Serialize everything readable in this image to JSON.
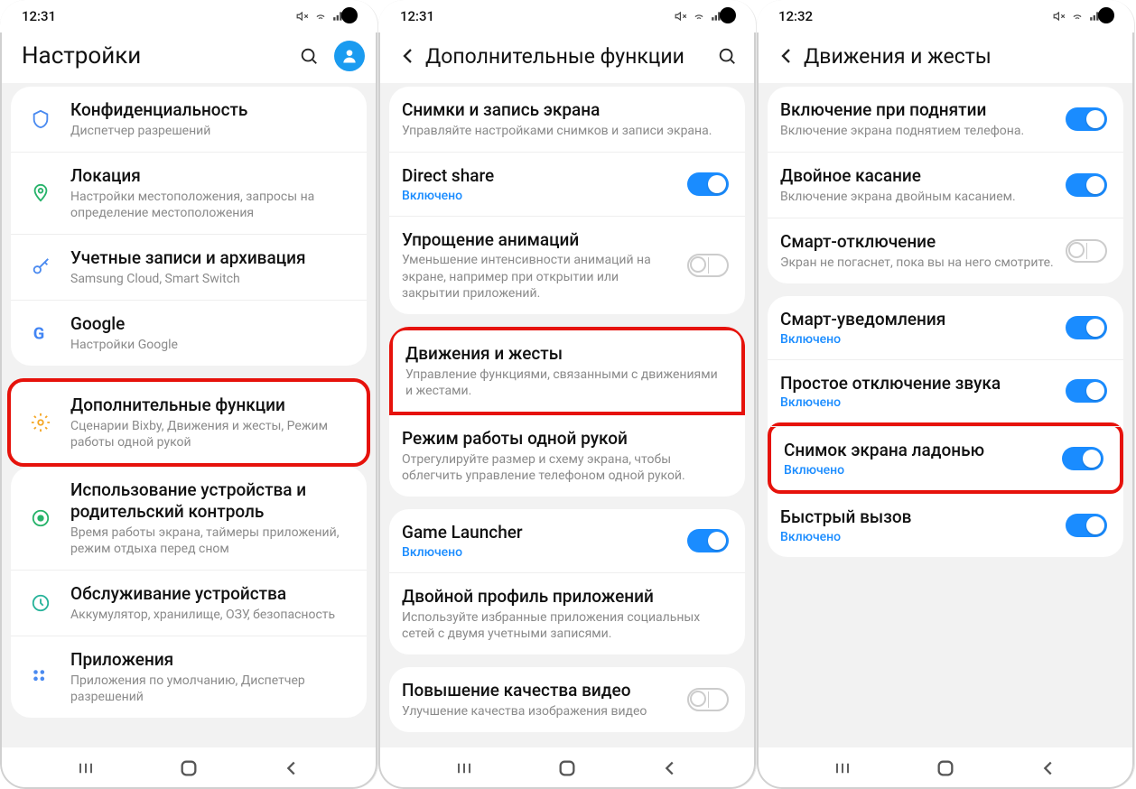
{
  "phones": [
    {
      "time": "12:31",
      "title": "Настройки",
      "has_back": false,
      "has_search": true,
      "has_avatar": true,
      "cards": [
        {
          "highlight_index": -1,
          "rows": [
            {
              "icon": "shield",
              "icon_color": "#4a8af0",
              "title": "Конфиденциальность",
              "sub": "Диспетчер разрешений"
            },
            {
              "icon": "pin",
              "icon_color": "#27b36a",
              "title": "Локация",
              "sub": "Настройки местоположения, запросы на определение местоположения"
            },
            {
              "icon": "key",
              "icon_color": "#4a8af0",
              "title": "Учетные записи и архивация",
              "sub": "Samsung Cloud, Smart Switch"
            },
            {
              "icon": "google",
              "icon_color": "#4285f4",
              "title": "Google",
              "sub": "Настройки Google"
            }
          ]
        },
        {
          "highlight_index": 0,
          "rows": [
            {
              "icon": "gear",
              "icon_color": "#f5a623",
              "title": "Дополнительные функции",
              "sub": "Сценарии Bixby, Движения и жесты, Режим работы одной рукой"
            }
          ]
        },
        {
          "highlight_index": -1,
          "rows": [
            {
              "icon": "wellbeing",
              "icon_color": "#27b36a",
              "title": "Использование устройства и родительский контроль",
              "sub": "Время работы экрана, таймеры приложений, режим отдыха перед сном"
            },
            {
              "icon": "care",
              "icon_color": "#27b39a",
              "title": "Обслуживание устройства",
              "sub": "Аккумулятор, хранилище, ОЗУ, безопасность"
            },
            {
              "icon": "apps",
              "icon_color": "#4a8af0",
              "title": "Приложения",
              "sub": "Приложения по умолчанию, Диспетчер разрешений"
            }
          ]
        }
      ]
    },
    {
      "time": "12:31",
      "title": "Дополнительные функции",
      "has_back": true,
      "has_search": true,
      "has_avatar": false,
      "cards": [
        {
          "highlight_index": -1,
          "rows": [
            {
              "title": "Снимки и запись экрана",
              "sub": "Управляйте настройками снимков и записи экрана."
            },
            {
              "title": "Direct share",
              "status": "Включено",
              "toggle": "on"
            },
            {
              "title": "Упрощение анимаций",
              "sub": "Уменьшение интенсивности анимаций на экране, например при открытии или закрытии приложений.",
              "toggle": "split"
            }
          ]
        },
        {
          "highlight_index": 0,
          "rows": [
            {
              "title": "Движения и жесты",
              "sub": "Управление функциями, связанными с движениями и жестами."
            },
            {
              "title": "Режим работы одной рукой",
              "sub": "Отрегулируйте размер и схему экрана, чтобы облегчить управление телефоном одной рукой."
            }
          ]
        },
        {
          "highlight_index": -1,
          "rows": [
            {
              "title": "Game Launcher",
              "status": "Включено",
              "toggle": "on"
            },
            {
              "title": "Двойной профиль приложений",
              "sub": "Используйте избранные приложения социальных сетей с двумя учетными записями."
            }
          ]
        },
        {
          "highlight_index": -1,
          "rows": [
            {
              "title": "Повышение качества видео",
              "sub": "Улучшение качества изображения видео",
              "toggle": "split"
            }
          ]
        }
      ]
    },
    {
      "time": "12:32",
      "title": "Движения и жесты",
      "has_back": true,
      "has_search": false,
      "has_avatar": false,
      "cards": [
        {
          "highlight_index": -1,
          "rows": [
            {
              "title": "Включение при поднятии",
              "sub": "Включение экрана поднятием телефона.",
              "toggle": "on"
            },
            {
              "title": "Двойное касание",
              "sub": "Включение экрана двойным касанием.",
              "toggle": "on"
            },
            {
              "title": "Смарт-отключение",
              "sub": "Экран не погаснет, пока вы на него смотрите.",
              "toggle": "split"
            }
          ]
        },
        {
          "highlight_index": 3,
          "rows": [
            {
              "title": "Смарт-уведомления",
              "status": "Включено",
              "toggle": "on"
            },
            {
              "title": "Простое отключение звука",
              "status": "Включено",
              "toggle": "on"
            },
            {
              "title": "Быстрый вызов",
              "status": "Включено",
              "toggle": "on"
            }
          ],
          "insert_highlight": {
            "position": 2,
            "title": "Снимок экрана ладонью",
            "status": "Включено",
            "toggle": "on"
          }
        }
      ]
    }
  ]
}
